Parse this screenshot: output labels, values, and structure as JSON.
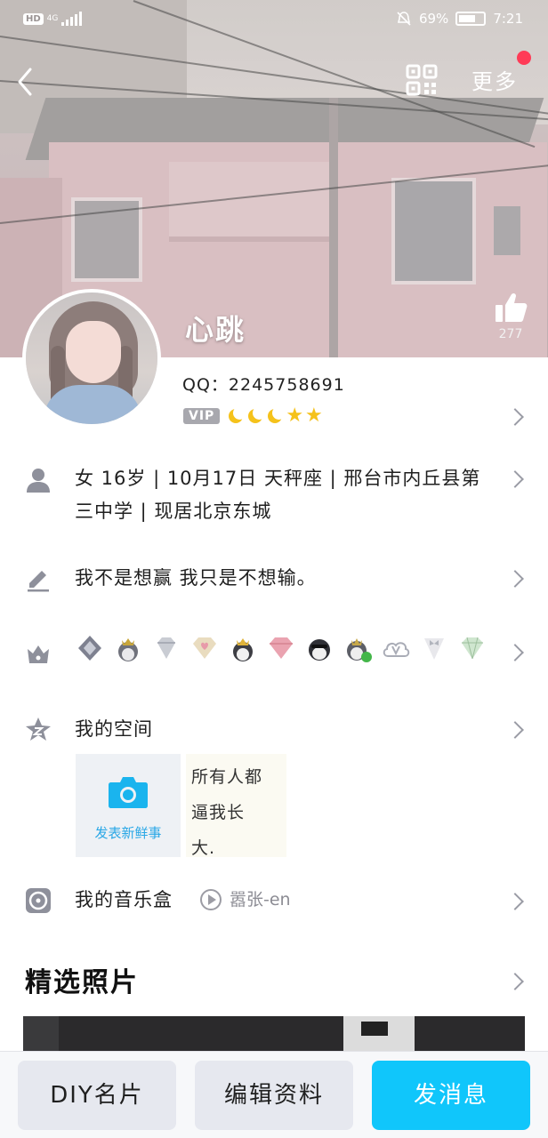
{
  "status_bar": {
    "hd": "HD",
    "network": "4G",
    "battery": "69%",
    "battery_level": 0.69,
    "time": "7:21"
  },
  "header": {
    "more_label": "更多",
    "back_icon": "chevron-left-icon",
    "qr_icon": "qr-code-icon"
  },
  "profile": {
    "nickname": "心跳",
    "like_count": "277",
    "qq_label": "QQ：2245758691",
    "vip_label": "VIP",
    "level_icons": [
      "moon",
      "moon",
      "moon",
      "star",
      "star"
    ]
  },
  "info_row": {
    "line1": "女  16岁  |  10月17日  天秤座  |  邢台市内丘县第",
    "line2": "三中学  |  现居北京东城"
  },
  "signature_row": {
    "text": "我不是想赢 我只是不想输。"
  },
  "badge_row": {
    "icons": [
      "diamond-badge-icon",
      "penguin-crown-icon",
      "diamond-icon",
      "pink-diamond-icon",
      "penguin-crown-icon",
      "pink-diamond-icon",
      "penguin-glasses-icon",
      "penguin-vip-icon",
      "cloud-v-icon",
      "tuxedo-icon",
      "green-diamond-icon"
    ]
  },
  "space_row": {
    "title": "我的空间",
    "post_label": "发表新鲜事",
    "card_lines": [
      "所有人都",
      "逼我长",
      "大."
    ]
  },
  "music_row": {
    "title": "我的音乐盒",
    "song": "嚣张-en"
  },
  "photos_section": {
    "title": "精选照片"
  },
  "bottom_bar": {
    "diy_label": "DIY名片",
    "edit_label": "编辑资料",
    "message_label": "发消息"
  },
  "colors": {
    "accent": "#10c6fb",
    "vip_badge": "#a8a8ae",
    "level_gold": "#f5c21b",
    "notification_dot": "#ff3b57",
    "post_label": "#29a7e6"
  }
}
